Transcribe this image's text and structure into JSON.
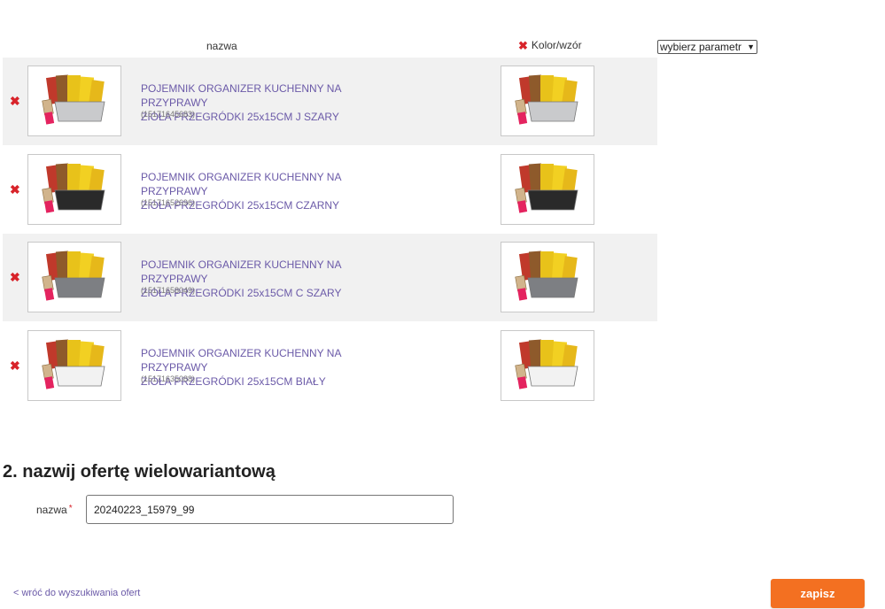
{
  "table": {
    "col_name": "nazwa",
    "col_color": "Kolor/wzór",
    "param_select_value": "wybierz parametr"
  },
  "products": [
    {
      "line1": "POJEMNIK ORGANIZER KUCHENNY NA PRZYPRAWY",
      "line2": "ZIOŁA PRZEGRÓDKI 25x15CM J SZARY",
      "code": "(15171645683)",
      "tray_color": "#c9cacc"
    },
    {
      "line1": "POJEMNIK ORGANIZER KUCHENNY NA PRZYPRAWY",
      "line2": "ZIOŁA PRZEGRÓDKI 25x15CM CZARNY",
      "code": "(15171652696)",
      "tray_color": "#2a2a2a"
    },
    {
      "line1": "POJEMNIK ORGANIZER KUCHENNY NA PRZYPRAWY",
      "line2": "ZIOŁA PRZEGRÓDKI 25x15CM C SZARY",
      "code": "(15171658049)",
      "tray_color": "#7d7f83"
    },
    {
      "line1": "POJEMNIK ORGANIZER KUCHENNY NA PRZYPRAWY",
      "line2": "ZIOŁA PRZEGRÓDKI 25x15CM BIAŁY",
      "code": "(15171635088)",
      "tray_color": "#f2f2f2"
    }
  ],
  "section2": {
    "title": "2. nazwij ofertę wielowariantową",
    "name_label": "nazwa",
    "required_mark": "*",
    "name_value": "20240223_15979_99"
  },
  "footer": {
    "back_link": "< wróć do wyszukiwania ofert",
    "save_label": "zapisz"
  },
  "colors": {
    "accent": "#f37021",
    "link": "#6b5aa8",
    "remove": "#d8232a"
  }
}
